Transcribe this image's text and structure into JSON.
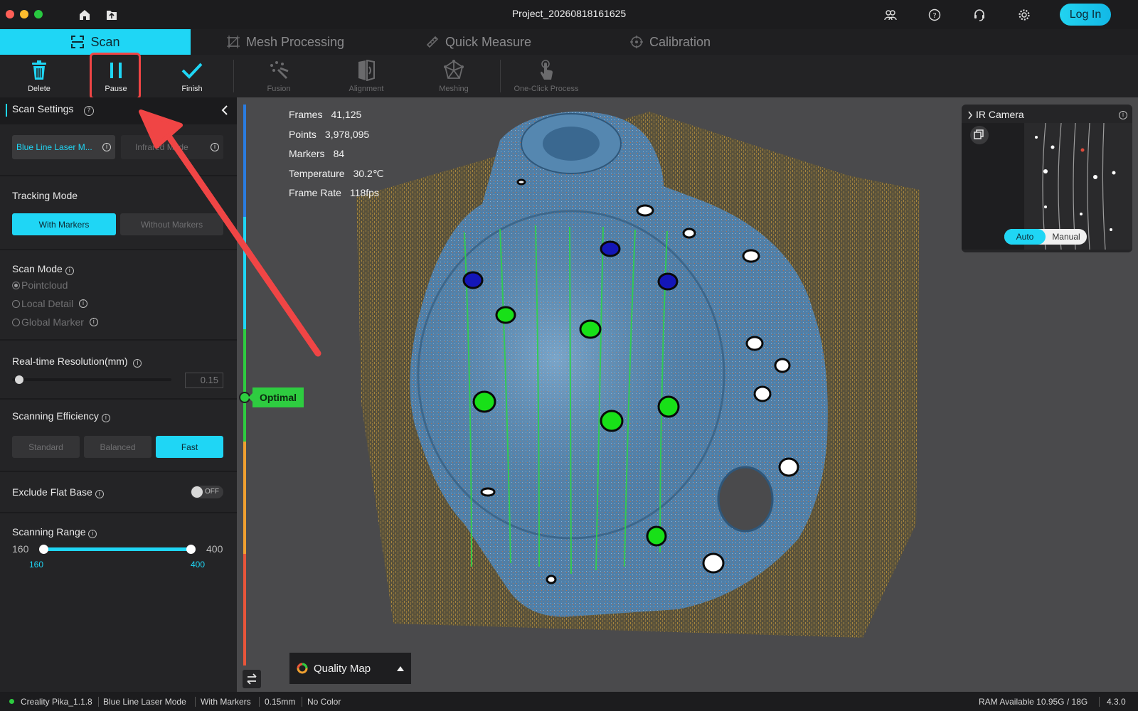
{
  "window": {
    "title": "Project_20260818161625",
    "login_label": "Log In"
  },
  "tabs": [
    {
      "label": "Scan",
      "icon": "scan-frame-icon",
      "active": true
    },
    {
      "label": "Mesh Processing",
      "icon": "mesh-icon"
    },
    {
      "label": "Quick Measure",
      "icon": "ruler-icon"
    },
    {
      "label": "Calibration",
      "icon": "crosshair-icon"
    }
  ],
  "toolbar": {
    "delete": "Delete",
    "pause": "Pause",
    "finish": "Finish",
    "fusion": "Fusion",
    "alignment": "Alignment",
    "meshing": "Meshing",
    "one_click": "One-Click Process"
  },
  "sidebar": {
    "title": "Scan Settings",
    "mode_blue": "Blue Line Laser M...",
    "mode_infrared": "Infrared Mode",
    "tracking_label": "Tracking Mode",
    "tracking_with": "With Markers",
    "tracking_without": "Without Markers",
    "scan_mode_label": "Scan Mode",
    "scan_modes": [
      "Pointcloud",
      "Local Detail",
      "Global Marker"
    ],
    "resolution_label": "Real-time Resolution(mm)",
    "resolution_value": "0.15",
    "efficiency_label": "Scanning Efficiency",
    "efficiency": [
      "Standard",
      "Balanced",
      "Fast"
    ],
    "efficiency_selected": "Fast",
    "exclude_label": "Exclude Flat Base",
    "exclude_toggle": "OFF",
    "range_label": "Scanning Range",
    "range_min": "160",
    "range_max": "400",
    "range_low": "160",
    "range_high": "400"
  },
  "stats": {
    "frames_label": "Frames",
    "frames": "41,125",
    "points_label": "Points",
    "points": "3,978,095",
    "markers_label": "Markers",
    "markers": "84",
    "temp_label": "Temperature",
    "temp": "30.2℃",
    "rate_label": "Frame Rate",
    "rate": "118fps"
  },
  "quality": {
    "indicator": "Optimal",
    "map_label": "Quality Map"
  },
  "ir_camera": {
    "title": "IR Camera",
    "auto": "Auto",
    "manual": "Manual"
  },
  "status": {
    "app": "Creality Pika_1.1.8",
    "mode": "Blue Line Laser Mode",
    "tracking": "With Markers",
    "resolution": "0.15mm",
    "color": "No Color",
    "ram": "RAM Available 10.95G / 18G",
    "version": "4.3.0"
  },
  "colors": {
    "accent": "#1fd6f5",
    "optimal": "#2ecc40",
    "highlight": "#f04545"
  }
}
